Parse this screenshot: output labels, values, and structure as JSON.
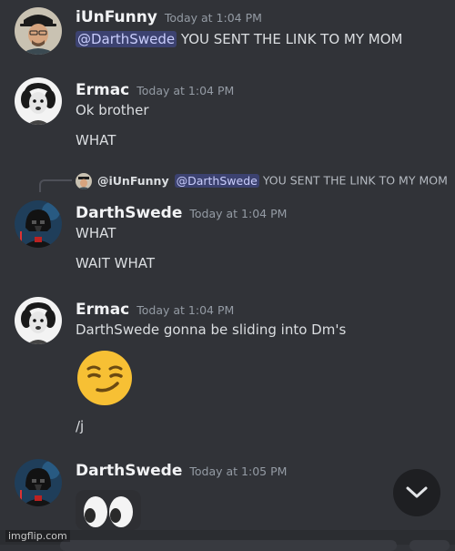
{
  "messages": [
    {
      "username": "iUnFunny",
      "timestamp": "Today at 1:04 PM",
      "mention": "@DarthSwede",
      "text": " YOU SENT THE LINK TO MY MOM"
    },
    {
      "username": "Ermac",
      "timestamp": "Today at 1:04 PM",
      "lines": [
        "Ok brother",
        "WHAT"
      ]
    },
    {
      "reply": {
        "author": "@iUnFunny",
        "mention": "@DarthSwede",
        "text": " YOU SENT THE LINK TO MY MOM"
      },
      "username": "DarthSwede",
      "timestamp": "Today at 1:04 PM",
      "lines": [
        "WHAT",
        "WAIT WHAT"
      ]
    },
    {
      "username": "Ermac",
      "timestamp": "Today at 1:04 PM",
      "lines": [
        "DarthSwede gonna be sliding into Dm's",
        "/j"
      ],
      "emoji": "smirking-face"
    },
    {
      "username": "DarthSwede",
      "timestamp": "Today at 1:05 PM",
      "emoji": "eyes"
    }
  ],
  "watermark": "imgflip.com",
  "colors": {
    "background": "#313338",
    "mention_bg": "#3c4270",
    "mention_text": "#c9cdfb",
    "timestamp": "#949ba4"
  }
}
